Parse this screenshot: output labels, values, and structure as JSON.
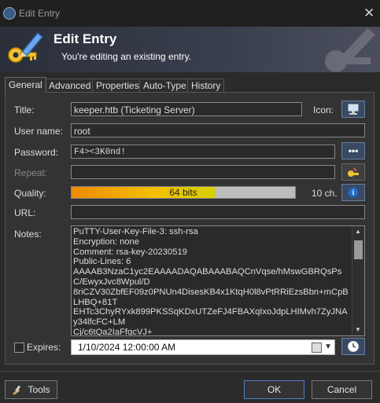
{
  "window": {
    "title": "Edit Entry",
    "close_glyph": "✕"
  },
  "banner": {
    "title": "Edit Entry",
    "subtitle": "You're editing an existing entry."
  },
  "tabs": [
    {
      "label": "General",
      "active": true
    },
    {
      "label": "Advanced"
    },
    {
      "label": "Properties"
    },
    {
      "label": "Auto-Type"
    },
    {
      "label": "History"
    }
  ],
  "form": {
    "title_label": "Title:",
    "title_value": "keeper.htb (Ticketing Server)",
    "icon_label": "Icon:",
    "username_label": "User name:",
    "username_value": "root",
    "password_label": "Password:",
    "password_value": "F4><3K0nd!",
    "reveal_glyph": "•••",
    "repeat_label": "Repeat:",
    "repeat_value": "",
    "quality_label": "Quality:",
    "quality_bits_text": "64 bits",
    "quality_fraction": 0.64,
    "quality_chars": "10 ch.",
    "info_glyph": "i",
    "url_label": "URL:",
    "url_value": "",
    "notes_label": "Notes:",
    "notes_value": "PuTTY-User-Key-File-3: ssh-rsa\nEncryption: none\nComment: rsa-key-20230519\nPublic-Lines: 6\nAAAAB3NzaC1yc2EAAAADAQABAAABAQCnVqse/hMswGBRQsPsC/EwyxJvc8Wpul/D\n8riCZV30ZbfEF09z0PNUn4DisesKB4x1KtqH0l8vPtRRiEzsBbn+mCpBLHBQ+81T\nEHTc3ChyRYxk899PKSSqKDxUTZeFJ4FBAXqIxoJdpLHIMvh7ZyJNAy34lfcFC+LM\nCj/c6tQa2IaFfqcVJ+",
    "expires_label": "Expires:",
    "expires_value": "1/10/2024 12:00:00 AM",
    "expires_checked": false
  },
  "buttons": {
    "tools": "Tools",
    "ok": "OK",
    "cancel": "Cancel"
  },
  "colors": {
    "accent": "#4e7fc5",
    "icon_button": "#3a4a64",
    "quality_start": "#f08a00",
    "quality_end": "#d6d100"
  },
  "icons": [
    "keepass-lock-icon",
    "edit-key-pen-icon",
    "computer-icon",
    "reveal-password-icon",
    "password-generator-icon",
    "info-icon",
    "calendar-icon",
    "expiry-clock-icon",
    "tools-icon"
  ]
}
